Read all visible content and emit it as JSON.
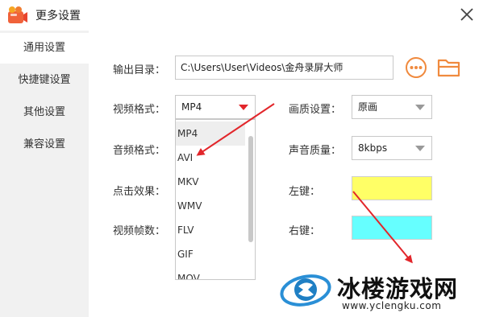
{
  "window": {
    "title": "更多设置"
  },
  "sidebar": {
    "items": [
      {
        "label": "通用设置",
        "active": true
      },
      {
        "label": "快捷键设置",
        "active": false
      },
      {
        "label": "其他设置",
        "active": false
      },
      {
        "label": "兼容设置",
        "active": false
      }
    ]
  },
  "general": {
    "output_dir_label": "输出目录：",
    "output_dir_value": "C:\\Users\\User\\Videos\\金舟录屏大师",
    "video_format_label": "视频格式：",
    "video_format_value": "MP4",
    "audio_format_label": "音频格式：",
    "click_effect_label": "点击效果：",
    "frame_rate_label": "视频帧数：",
    "quality_label": "画质设置：",
    "quality_value": "原画",
    "sound_quality_label": "声音质量：",
    "sound_quality_value": "8kbps",
    "left_key_label": "左键：",
    "right_key_label": "右键：",
    "left_key_color": "#ffff66",
    "right_key_color": "#66ffff"
  },
  "format_dropdown": {
    "options": [
      "MP4",
      "AVI",
      "MKV",
      "WMV",
      "FLV",
      "GIF",
      "MOV"
    ],
    "highlighted": "MP4"
  },
  "watermark": {
    "name": "冰楼游戏网",
    "url": "www.yclengku.com"
  },
  "colors": {
    "accent_orange": "#f08a3e",
    "annotation_red": "#e2262b"
  }
}
